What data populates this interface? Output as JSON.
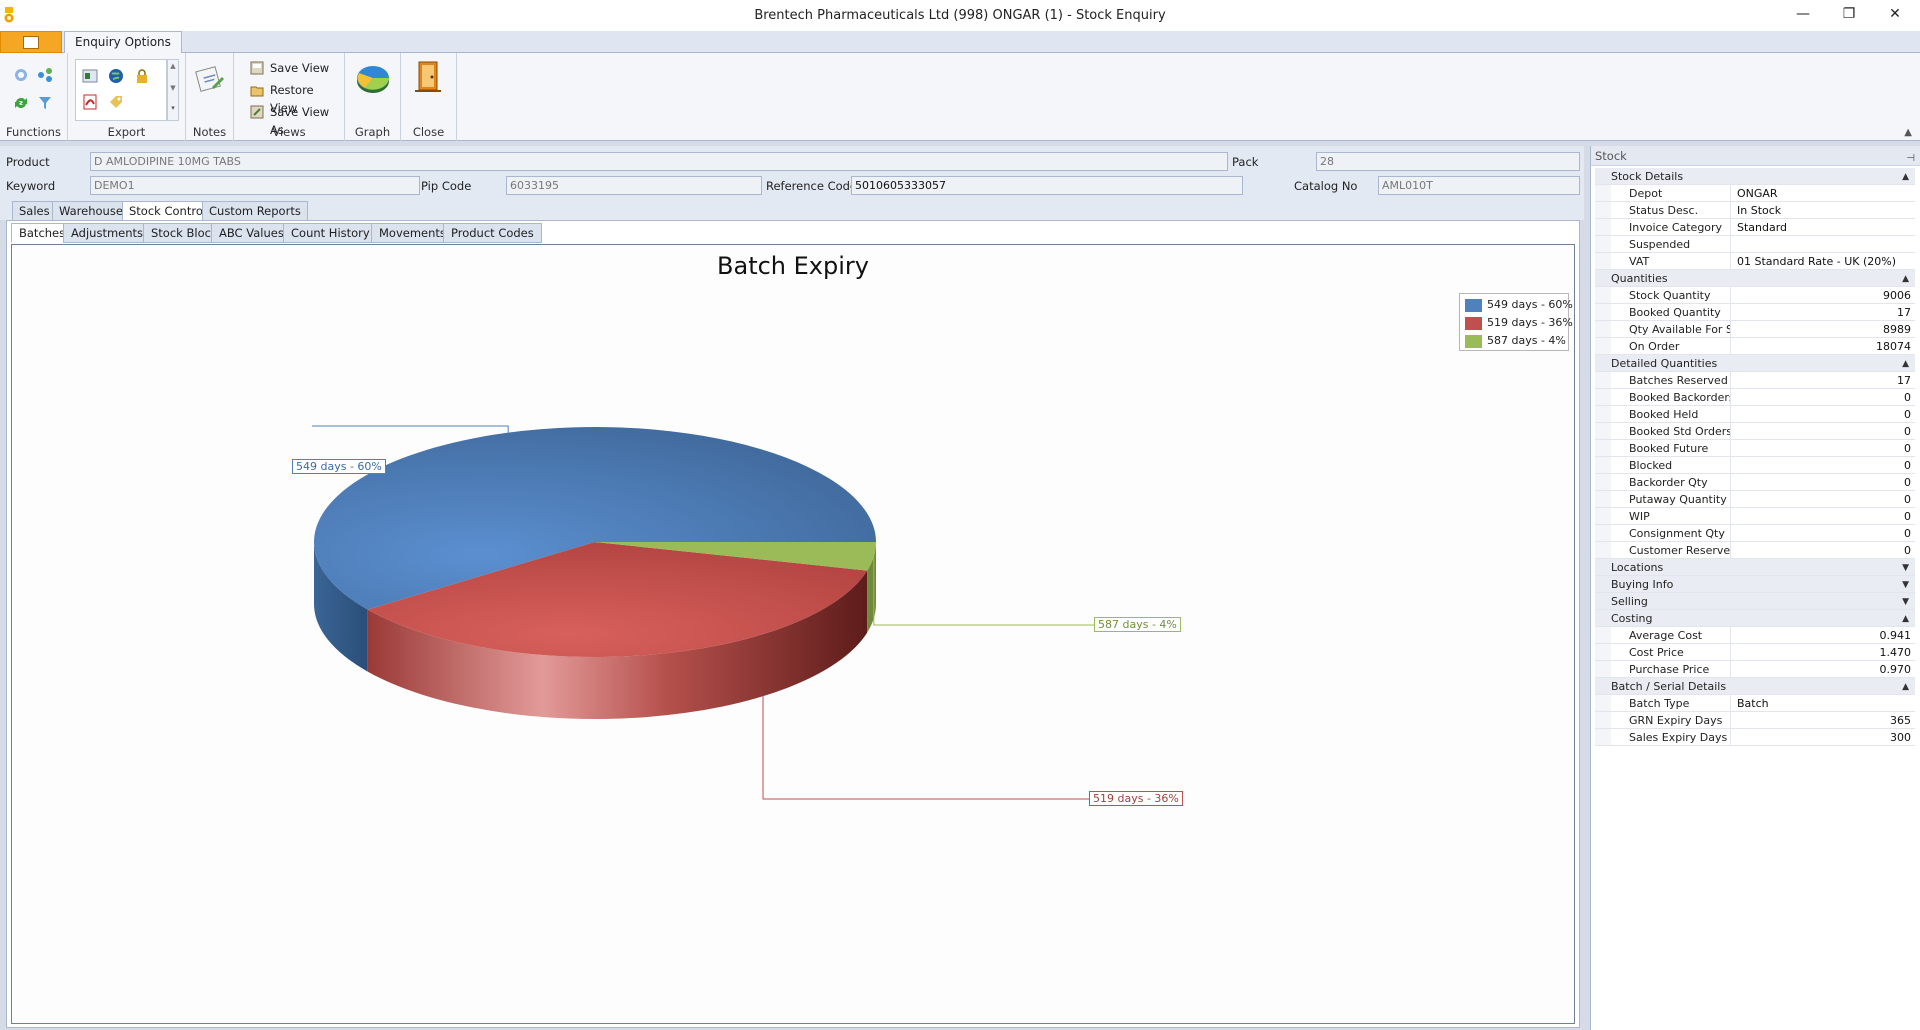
{
  "window": {
    "title": "Brentech Pharmaceuticals Ltd (998) ONGAR (1) - Stock Enquiry",
    "minimize": "—",
    "restore": "❐",
    "close": "✕"
  },
  "ribbon": {
    "tab": "Enquiry Options",
    "groups": {
      "functions": "Functions",
      "export": "Export",
      "notes": "Notes",
      "views": "Views",
      "graph": "Graph",
      "close": "Close"
    },
    "views": {
      "save_view": "Save View",
      "restore_view": "Restore View",
      "save_view_as": "Save View As"
    }
  },
  "fields": {
    "product_label": "Product",
    "product_value": "D AMLODIPINE 10MG TABS",
    "pack_label": "Pack",
    "pack_value": "28",
    "keyword_label": "Keyword",
    "keyword_value": "DEMO1",
    "pip_label": "Pip Code",
    "pip_value": "6033195",
    "ref_label": "Reference Code",
    "ref_value": "5010605333057",
    "catalog_label": "Catalog No",
    "catalog_value": "AML010T"
  },
  "main_tabs": [
    "Sales",
    "Warehouse",
    "Stock Control",
    "Custom Reports"
  ],
  "sub_tabs": [
    "Batches",
    "Adjustments",
    "Stock Block",
    "ABC Values",
    "Count History",
    "Movements",
    "Product Codes"
  ],
  "chart_data": {
    "type": "pie",
    "title": "Batch Expiry",
    "categories": [
      "549 days - 60%",
      "519 days - 36%",
      "587 days - 4%"
    ],
    "values": [
      60,
      36,
      4
    ],
    "colors": [
      "#4f81bd",
      "#c0504d",
      "#9bbb59"
    ],
    "legend": "top-right"
  },
  "stock_panel": {
    "title": "Stock",
    "categories": [
      {
        "name": "Stock Details",
        "expanded": true,
        "props": [
          {
            "name": "Depot",
            "value": "ONGAR"
          },
          {
            "name": "Status Desc.",
            "value": "In Stock"
          },
          {
            "name": "Invoice Category",
            "value": "Standard"
          },
          {
            "name": "Suspended",
            "value": ""
          },
          {
            "name": "VAT",
            "value": "01 Standard Rate - UK (20%)"
          }
        ]
      },
      {
        "name": "Quantities",
        "expanded": true,
        "props": [
          {
            "name": "Stock Quantity",
            "value": "9006"
          },
          {
            "name": "Booked Quantity",
            "value": "17"
          },
          {
            "name": "Qty Available For Sale",
            "value": "8989"
          },
          {
            "name": "On Order",
            "value": "18074"
          }
        ]
      },
      {
        "name": "Detailed Quantities",
        "expanded": true,
        "props": [
          {
            "name": "Batches Reserved",
            "value": "17"
          },
          {
            "name": "Booked Backorders",
            "value": "0"
          },
          {
            "name": "Booked Held",
            "value": "0"
          },
          {
            "name": "Booked Std Orders",
            "value": "0"
          },
          {
            "name": "Booked Future",
            "value": "0"
          },
          {
            "name": "Blocked",
            "value": "0"
          },
          {
            "name": "Backorder Qty",
            "value": "0"
          },
          {
            "name": "Putaway Quantity",
            "value": "0"
          },
          {
            "name": "WIP",
            "value": "0"
          },
          {
            "name": "Consignment Qty",
            "value": "0"
          },
          {
            "name": "Customer Reserve Qty",
            "value": "0"
          }
        ]
      },
      {
        "name": "Locations",
        "expanded": false,
        "props": []
      },
      {
        "name": "Buying Info",
        "expanded": false,
        "props": []
      },
      {
        "name": "Selling",
        "expanded": false,
        "props": []
      },
      {
        "name": "Costing",
        "expanded": true,
        "props": [
          {
            "name": "Average Cost",
            "value": "0.941"
          },
          {
            "name": "Cost Price",
            "value": "1.470"
          },
          {
            "name": "Purchase Price",
            "value": "0.970"
          }
        ]
      },
      {
        "name": "Batch / Serial Details",
        "expanded": true,
        "props": [
          {
            "name": "Batch Type",
            "value": "Batch"
          },
          {
            "name": "GRN Expiry Days",
            "value": "365"
          },
          {
            "name": "Sales Expiry Days",
            "value": "300"
          }
        ]
      }
    ]
  }
}
